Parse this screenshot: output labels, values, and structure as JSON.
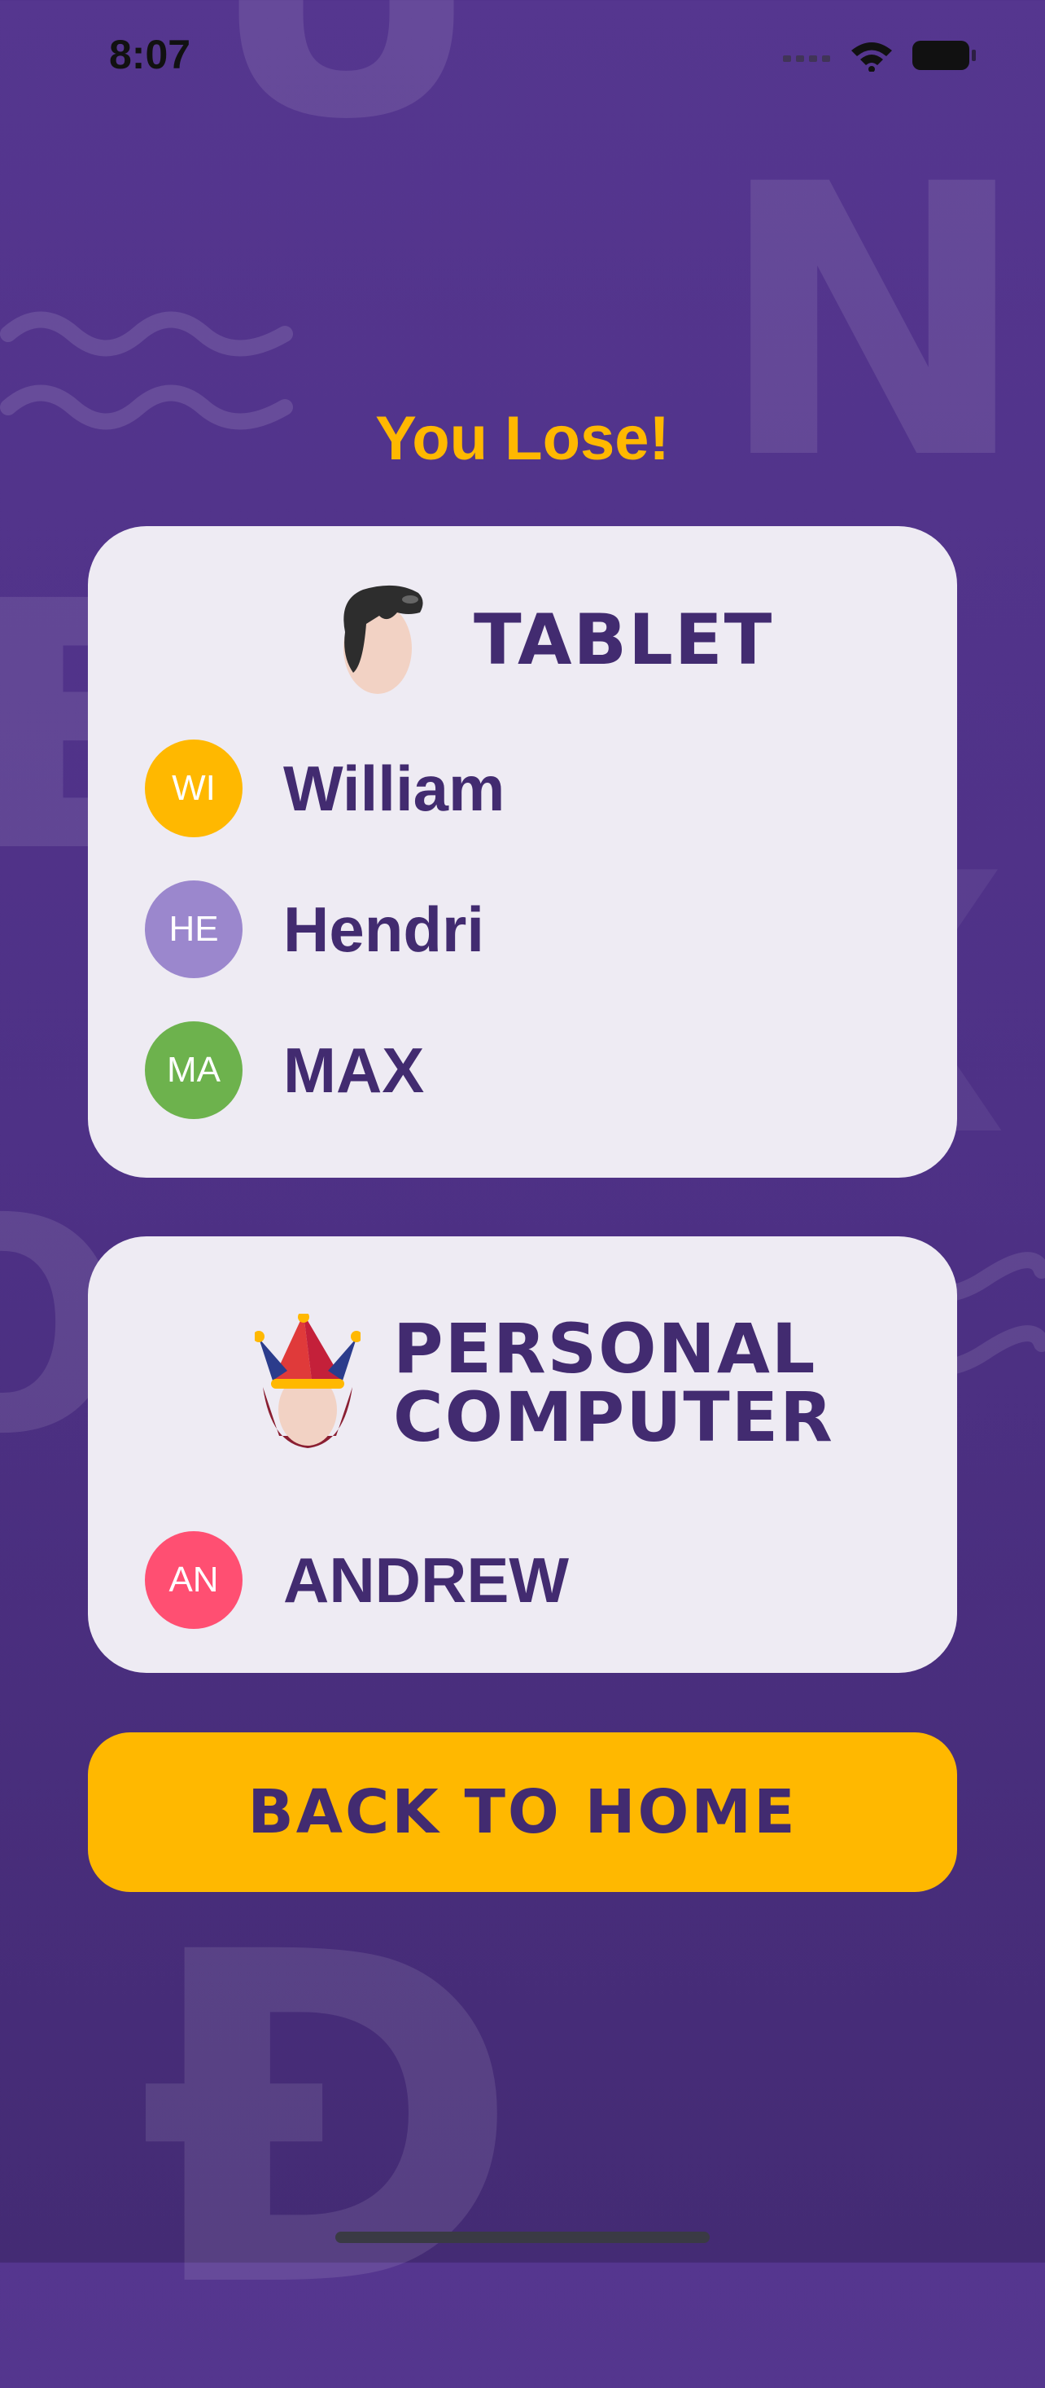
{
  "status_bar": {
    "time": "8:07",
    "icons": [
      "signal-icon",
      "wifi-icon",
      "battery-icon"
    ]
  },
  "result_title": "You Lose!",
  "teams": [
    {
      "name": "TABLET",
      "icon": "elvis-hair-head-icon",
      "players": [
        {
          "initials": "WI",
          "name": "William",
          "color": "#ffb800"
        },
        {
          "initials": "HE",
          "name": "Hendri",
          "color": "#9b87cd"
        },
        {
          "initials": "MA",
          "name": "MAX",
          "color": "#6db24d"
        }
      ]
    },
    {
      "name_line1": "PERSONAL",
      "name_line2": "COMPUTER",
      "icon": "jester-head-icon",
      "players": [
        {
          "initials": "AN",
          "name": "ANDREW",
          "color": "#ff4f72"
        }
      ]
    }
  ],
  "back_button_label": "BACK TO HOME",
  "colors": {
    "background": "#52358b",
    "accent": "#ffb800",
    "card": "#eeebf3",
    "text_dark": "#422b70"
  }
}
